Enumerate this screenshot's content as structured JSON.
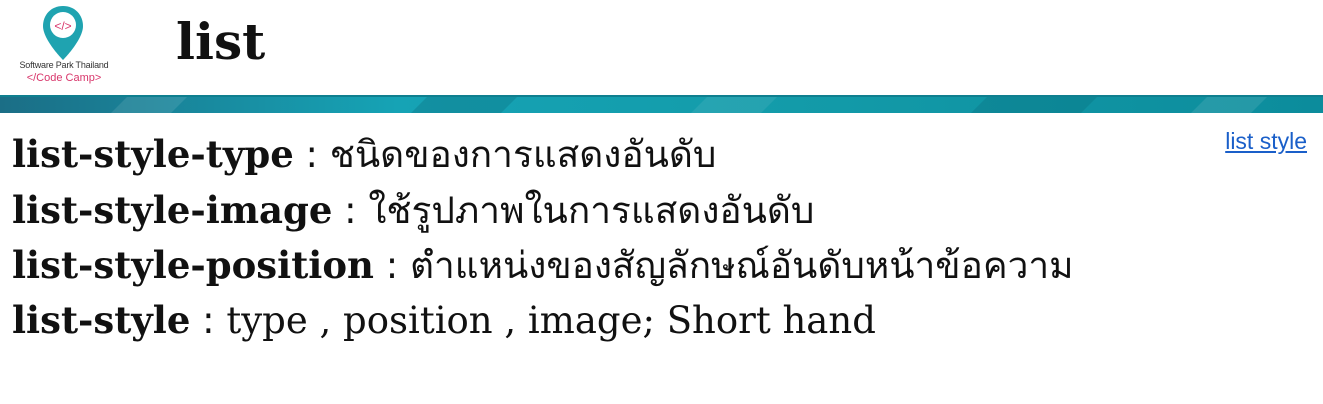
{
  "logo": {
    "org_name": "Software Park Thailand",
    "tagline": "</Code Camp>",
    "icon": "map-pin-code-icon",
    "pin_color": "#1fa3b0",
    "accent_color": "#d8366b"
  },
  "header": {
    "title": "list"
  },
  "banner": {
    "colors": [
      "#1b6e86",
      "#16a3b5",
      "#0c8c9c"
    ]
  },
  "link": {
    "label": "list style",
    "color": "#1a5fc9"
  },
  "properties": [
    {
      "term": "list-style-type",
      "separator": " : ",
      "description": "ชนิดของการแสดงอันดับ"
    },
    {
      "term": "list-style-image",
      "separator": " : ",
      "description": "ใช้รูปภาพในการแสดงอันดับ"
    },
    {
      "term": "list-style-position",
      "separator": " : ",
      "description": "ตำแหน่งของสัญลักษณ์อันดับหน้าข้อความ"
    },
    {
      "term": "list-style",
      "separator": " : ",
      "description": "type , position , image; Short hand"
    }
  ]
}
